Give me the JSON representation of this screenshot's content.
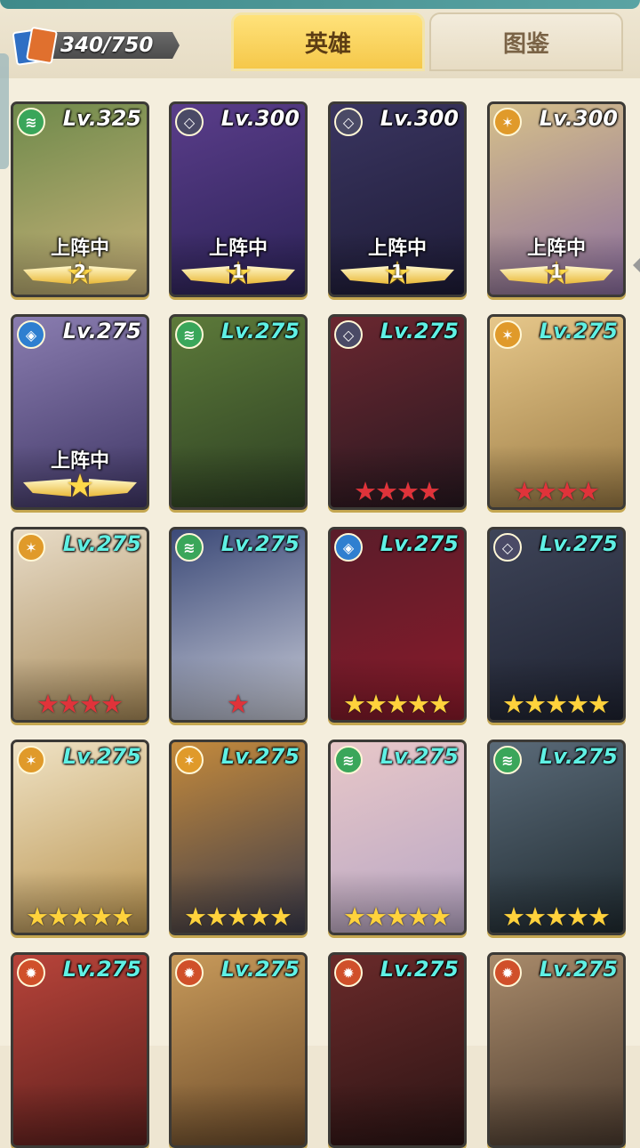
{
  "header": {
    "counter": "340/750",
    "tabs": [
      {
        "label": "英雄",
        "active": true
      },
      {
        "label": "图鉴",
        "active": false
      }
    ]
  },
  "colors": {
    "level_white": "#ffffff",
    "level_teal": "#5ff0e4",
    "star_red": "#e0333a",
    "star_gold": "#ffd23c",
    "tab_active": "#f5c84a"
  },
  "heroes": [
    {
      "level": "Lv.325",
      "faction": "forest",
      "status": "上阵中",
      "rank": "2",
      "stars": null,
      "lv_color": "white",
      "bg": [
        "#6f8a4b",
        "#c9b27a"
      ]
    },
    {
      "level": "Lv.300",
      "faction": "shadow",
      "status": "上阵中",
      "rank": "1",
      "stars": null,
      "lv_color": "white",
      "bg": [
        "#5a3d8a",
        "#2b2256"
      ]
    },
    {
      "level": "Lv.300",
      "faction": "shadow",
      "status": "上阵中",
      "rank": "1",
      "stars": null,
      "lv_color": "white",
      "bg": [
        "#3a3560",
        "#1d1b36"
      ]
    },
    {
      "level": "Lv.300",
      "faction": "light",
      "status": "上阵中",
      "rank": "1",
      "stars": null,
      "lv_color": "white",
      "bg": [
        "#d6c08a",
        "#8a6d9e"
      ]
    },
    {
      "level": "Lv.275",
      "faction": "abyss",
      "status": "上阵中",
      "rank": "",
      "stars": null,
      "lv_color": "white",
      "bg": [
        "#8a7db0",
        "#3e3564"
      ]
    },
    {
      "level": "Lv.275",
      "faction": "forest",
      "status": "",
      "rank": "",
      "stars": null,
      "lv_color": "teal",
      "bg": [
        "#5d7a3a",
        "#2c3f22"
      ]
    },
    {
      "level": "Lv.275",
      "faction": "shadow",
      "status": "",
      "rank": "",
      "stars": {
        "count": 4,
        "color": "red"
      },
      "lv_color": "teal",
      "bg": [
        "#6a2730",
        "#281820"
      ]
    },
    {
      "level": "Lv.275",
      "faction": "light",
      "status": "",
      "rank": "",
      "stars": {
        "count": 4,
        "color": "red"
      },
      "lv_color": "teal",
      "bg": [
        "#e6c78a",
        "#9a7a44"
      ]
    },
    {
      "level": "Lv.275",
      "faction": "light",
      "status": "",
      "rank": "",
      "stars": {
        "count": 4,
        "color": "red"
      },
      "lv_color": "teal",
      "bg": [
        "#e8dcc8",
        "#a88a58"
      ]
    },
    {
      "level": "Lv.275",
      "faction": "forest",
      "status": "",
      "rank": "",
      "stars": {
        "count": 1,
        "color": "red"
      },
      "lv_color": "teal",
      "bg": [
        "#3c4a78",
        "#c9ccd8"
      ]
    },
    {
      "level": "Lv.275",
      "faction": "abyss",
      "status": "",
      "rank": "",
      "stars": {
        "count": 5,
        "color": "gold"
      },
      "lv_color": "teal",
      "bg": [
        "#5a1d2a",
        "#8a1a2a"
      ]
    },
    {
      "level": "Lv.275",
      "faction": "shadow",
      "status": "",
      "rank": "",
      "stars": {
        "count": 5,
        "color": "gold"
      },
      "lv_color": "teal",
      "bg": [
        "#3e4458",
        "#1e2230"
      ]
    },
    {
      "level": "Lv.275",
      "faction": "light",
      "status": "",
      "rank": "",
      "stars": {
        "count": 5,
        "color": "gold"
      },
      "lv_color": "teal",
      "bg": [
        "#efe2c4",
        "#b8924e"
      ]
    },
    {
      "level": "Lv.275",
      "faction": "light",
      "status": "",
      "rank": "",
      "stars": {
        "count": 5,
        "color": "gold"
      },
      "lv_color": "teal",
      "bg": [
        "#c48a3c",
        "#3a3a4a"
      ]
    },
    {
      "level": "Lv.275",
      "faction": "forest",
      "status": "",
      "rank": "",
      "stars": {
        "count": 5,
        "color": "gold"
      },
      "lv_color": "teal",
      "bg": [
        "#e8c7c8",
        "#b7a6c4"
      ]
    },
    {
      "level": "Lv.275",
      "faction": "forest",
      "status": "",
      "rank": "",
      "stars": {
        "count": 5,
        "color": "gold"
      },
      "lv_color": "teal",
      "bg": [
        "#5a6a78",
        "#1f2a30"
      ]
    },
    {
      "level": "Lv.275",
      "faction": "fire",
      "status": "",
      "rank": "",
      "stars": null,
      "lv_color": "teal",
      "bg": [
        "#b8443a",
        "#5a1e1c"
      ]
    },
    {
      "level": "Lv.275",
      "faction": "fire",
      "status": "",
      "rank": "",
      "stars": null,
      "lv_color": "teal",
      "bg": [
        "#c89a5a",
        "#6a4a2a"
      ]
    },
    {
      "level": "Lv.275",
      "faction": "fire",
      "status": "",
      "rank": "",
      "stars": null,
      "lv_color": "teal",
      "bg": [
        "#6a2a2a",
        "#2a1414"
      ]
    },
    {
      "level": "Lv.275",
      "faction": "fire",
      "status": "",
      "rank": "",
      "stars": null,
      "lv_color": "teal",
      "bg": [
        "#a88a6a",
        "#4a3a2e"
      ]
    }
  ]
}
